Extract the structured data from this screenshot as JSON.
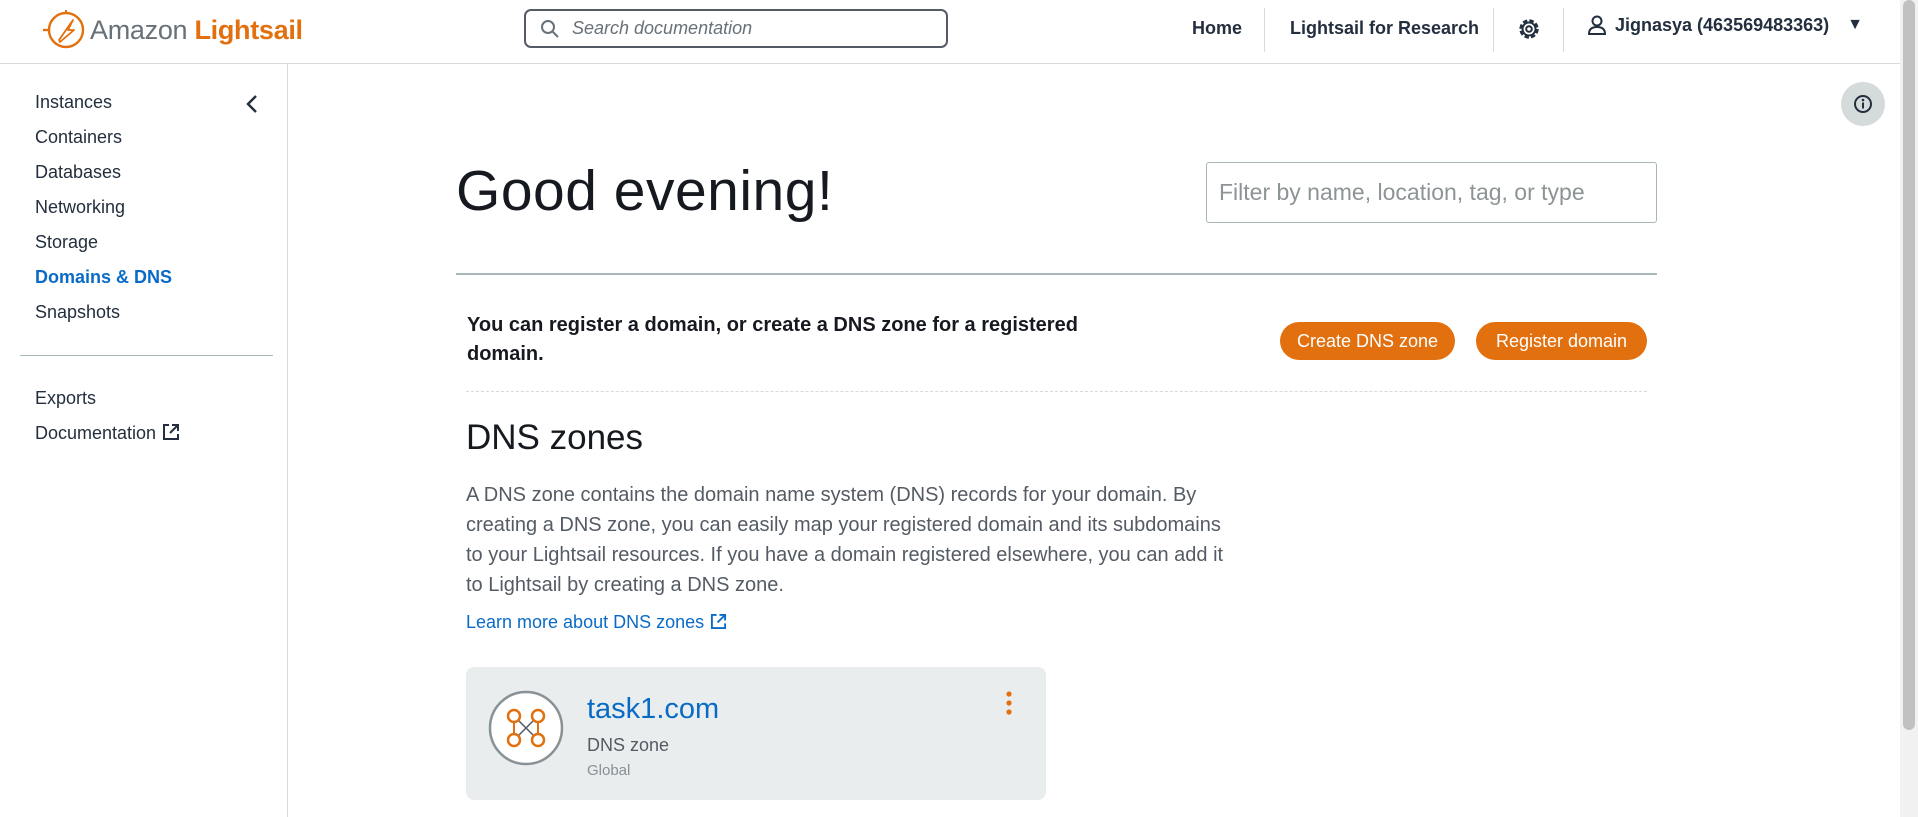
{
  "header": {
    "brand_prefix": "Amazon",
    "brand_name": "Lightsail",
    "search_placeholder": "Search documentation",
    "nav": [
      "Home",
      "Lightsail for Research"
    ],
    "account": "Jignasya (463569483363)"
  },
  "sidebar": {
    "items": [
      "Instances",
      "Containers",
      "Databases",
      "Networking",
      "Storage",
      "Domains & DNS",
      "Snapshots"
    ],
    "active": "Domains & DNS",
    "secondary": [
      "Exports",
      "Documentation"
    ]
  },
  "main": {
    "greeting": "Good evening!",
    "filter_placeholder": "Filter by name, location, tag, or type",
    "intro": "You can register a domain, or create a DNS zone for a registered domain.",
    "buttons": {
      "create": "Create DNS zone",
      "register": "Register domain"
    },
    "dns": {
      "title": "DNS zones",
      "description": "A DNS zone contains the domain name system (DNS) records for your domain. By creating a DNS zone, you can easily map your registered domain and its subdomains to your Lightsail resources. If you have a domain registered elsewhere, you can add it to Lightsail by creating a DNS zone.",
      "learn_more": "Learn more about DNS zones"
    },
    "zones": [
      {
        "name": "task1.com",
        "type": "DNS zone",
        "location": "Global"
      }
    ]
  },
  "colors": {
    "accent": "#e2700f",
    "link": "#0a6bc6",
    "text": "#16191f"
  }
}
